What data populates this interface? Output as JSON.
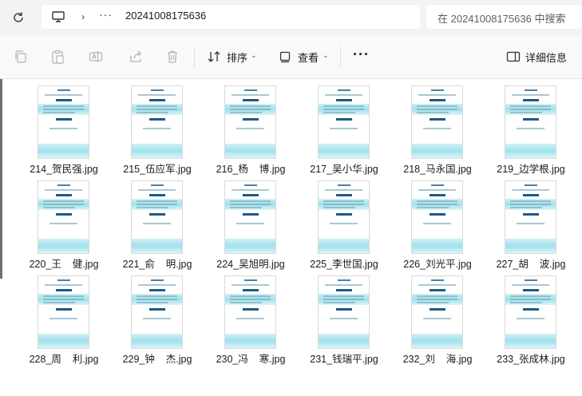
{
  "address": {
    "path": "20241008175636",
    "more": "···",
    "separator": "›",
    "search_placeholder": "在 20241008175636 中搜索"
  },
  "toolbar": {
    "sort_label": "排序",
    "view_label": "查看",
    "more_label": "···",
    "details_label": "详细信息"
  },
  "files": [
    {
      "name": "214_贺民强.jpg"
    },
    {
      "name": "215_伍应军.jpg"
    },
    {
      "name": "216_杨    博.jpg"
    },
    {
      "name": "217_吴小华.jpg"
    },
    {
      "name": "218_马永国.jpg"
    },
    {
      "name": "219_边学根.jpg"
    },
    {
      "name": "220_王    健.jpg"
    },
    {
      "name": "221_俞    明.jpg"
    },
    {
      "name": "224_吴旭明.jpg"
    },
    {
      "name": "225_李世国.jpg"
    },
    {
      "name": "226_刘光平.jpg"
    },
    {
      "name": "227_胡    波.jpg"
    },
    {
      "name": "228_周    利.jpg"
    },
    {
      "name": "229_钟    杰.jpg"
    },
    {
      "name": "230_冯    寒.jpg"
    },
    {
      "name": "231_钱瑞平.jpg"
    },
    {
      "name": "232_刘    海.jpg"
    },
    {
      "name": "233_张成林.jpg"
    }
  ]
}
